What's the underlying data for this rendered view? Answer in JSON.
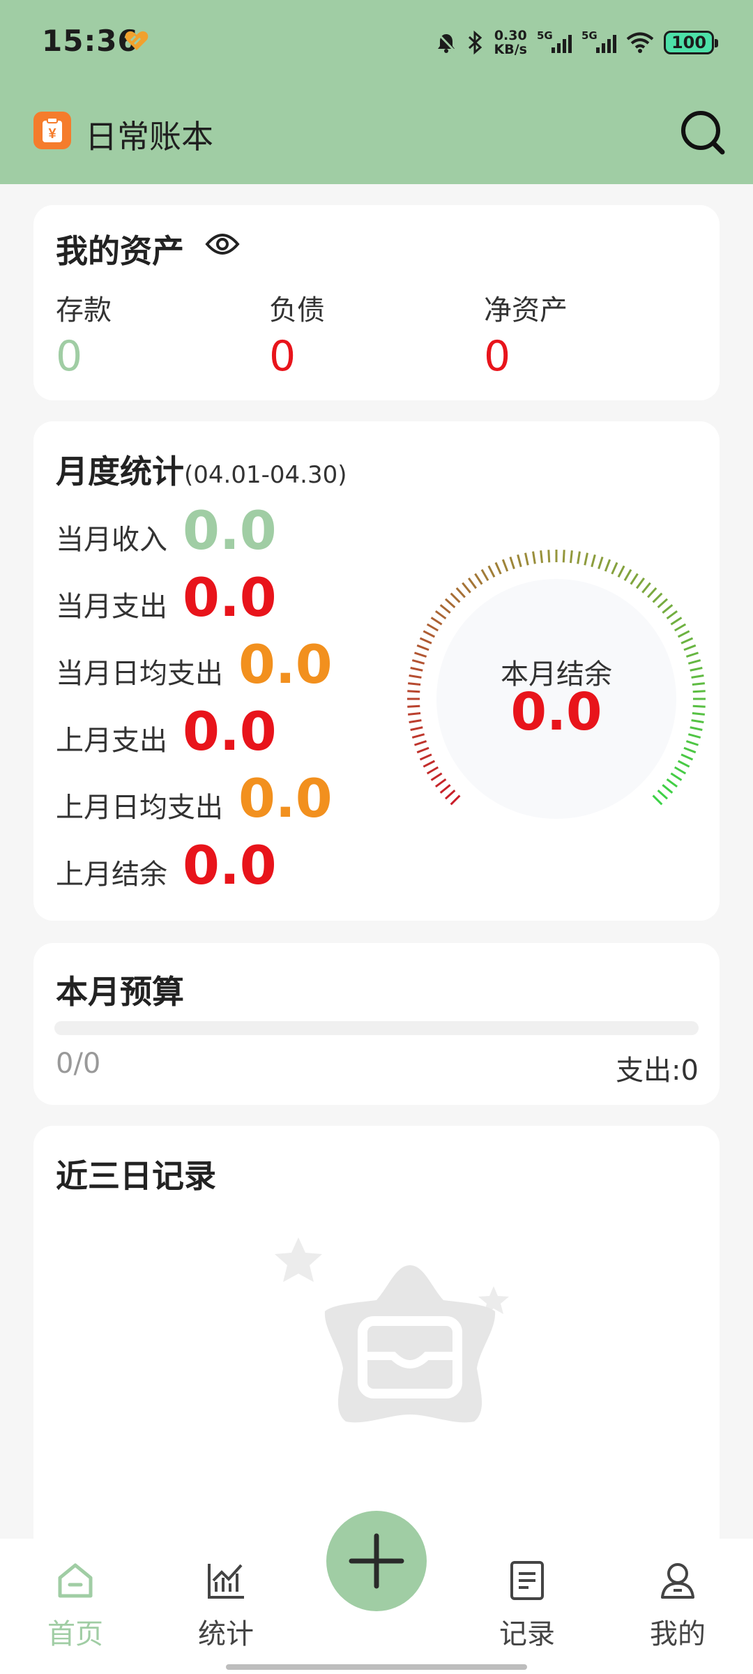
{
  "status_bar": {
    "time": "15:36",
    "net_speed_value": "0.30",
    "net_speed_unit": "KB/s",
    "sim1_label": "5G",
    "sim2_label": "5G",
    "battery": "100",
    "icons": [
      "heart-icon",
      "alarm-muted-icon",
      "bluetooth-icon",
      "signal-icon",
      "wifi-icon",
      "battery-icon"
    ]
  },
  "app_bar": {
    "title": "日常账本",
    "logo_symbol": "¥",
    "icons": [
      "app-logo-icon",
      "search-icon"
    ]
  },
  "assets": {
    "title": "我的资产",
    "items": [
      {
        "label": "存款",
        "value": "0",
        "color": "#a0cda4"
      },
      {
        "label": "负债",
        "value": "0",
        "color": "#e8141b"
      },
      {
        "label": "净资产",
        "value": "0",
        "color": "#e8141b"
      }
    ]
  },
  "monthly": {
    "title": "月度统计",
    "range": "(04.01-04.30)",
    "rows": [
      {
        "label": "当月收入",
        "value": "0.0",
        "color": "#a0cda4"
      },
      {
        "label": "当月支出",
        "value": "0.0",
        "color": "#e8141b"
      },
      {
        "label": "当月日均支出",
        "value": "0.0",
        "color": "#f2901e"
      },
      {
        "label": "上月支出",
        "value": "0.0",
        "color": "#e8141b"
      },
      {
        "label": "上月日均支出",
        "value": "0.0",
        "color": "#f2901e"
      },
      {
        "label": "上月结余",
        "value": "0.0",
        "color": "#e8141b"
      }
    ],
    "gauge": {
      "label": "本月结余",
      "value": "0.0",
      "level": 0
    }
  },
  "budget": {
    "title": "本月预算",
    "ratio": "0/0",
    "spend": "支出:0",
    "progress": 0
  },
  "recent": {
    "title": "近三日记录",
    "empty_icon": "empty-inbox-icon"
  },
  "tabs": [
    {
      "label": "首页",
      "icon": "home-icon",
      "active": true
    },
    {
      "label": "统计",
      "icon": "stats-icon",
      "active": false
    },
    {
      "label": "记录",
      "icon": "record-icon",
      "active": false
    },
    {
      "label": "我的",
      "icon": "profile-icon",
      "active": false
    }
  ],
  "colors": {
    "brand": "#a0cda4",
    "negative": "#e8141b",
    "warning": "#f2901e",
    "logo": "#f57c2c"
  }
}
